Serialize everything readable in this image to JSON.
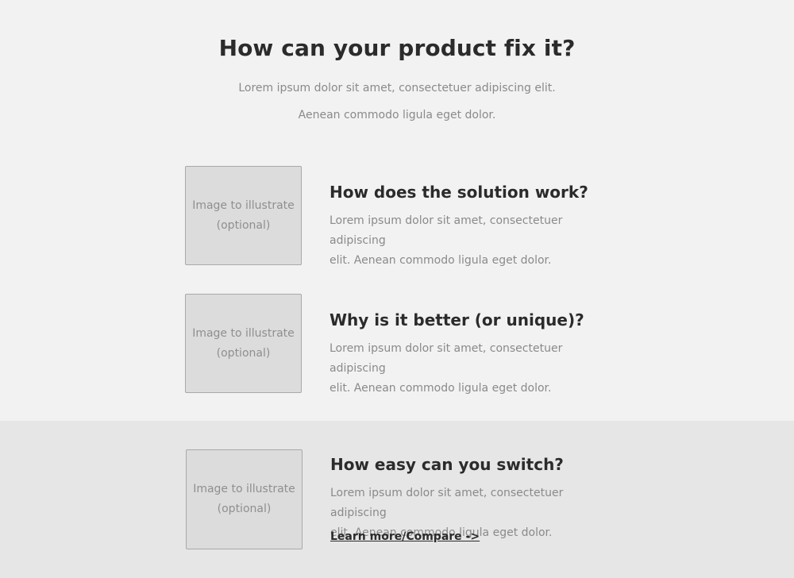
{
  "header": {
    "title": "How can your product fix it?",
    "subtitle_line1": "Lorem ipsum dolor sit amet, consectetuer adipiscing elit.",
    "subtitle_line2": "Aenean commodo ligula eget dolor."
  },
  "features": [
    {
      "image_label_line1": "Image to illustrate",
      "image_label_line2": "(optional)",
      "title": "How does the solution work?",
      "text_line1": "Lorem ipsum dolor sit amet, consectetuer adipiscing",
      "text_line2": "elit. Aenean commodo ligula eget dolor."
    },
    {
      "image_label_line1": "Image to illustrate",
      "image_label_line2": "(optional)",
      "title": "Why is it better (or unique)?",
      "text_line1": "Lorem ipsum dolor sit amet, consectetuer adipiscing",
      "text_line2": "elit. Aenean commodo ligula eget dolor."
    },
    {
      "image_label_line1": "Image to illustrate",
      "image_label_line2": "(optional)",
      "title": "How easy can you switch?",
      "text_line1": "Lorem ipsum dolor sit amet, consectetuer adipiscing",
      "text_line2": "elit. Aenean commodo ligula eget dolor.",
      "link_label": "Learn more/Compare ->"
    }
  ],
  "colors": {
    "background_top": "#f2f2f2",
    "background_bottom": "#e6e6e6",
    "heading": "#2b2b2b",
    "body_text": "#8a8a8a",
    "placeholder_fill": "#dcdcdc",
    "placeholder_border": "#a9a9a9"
  }
}
